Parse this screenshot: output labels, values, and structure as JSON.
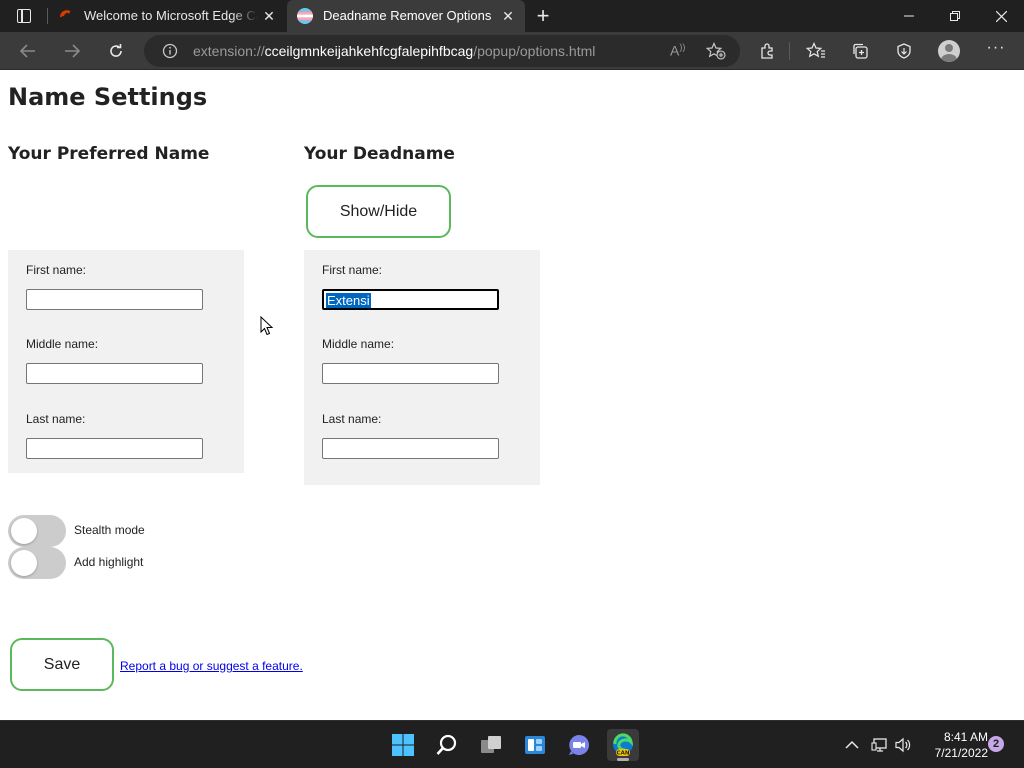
{
  "browser": {
    "tabs": [
      {
        "title": "Welcome to Microsoft Edge Canary",
        "icon": "edge-canary-icon",
        "active": false
      },
      {
        "title": "Deadname Remover Options",
        "icon": "trans-flag-icon",
        "active": true
      }
    ],
    "url": {
      "scheme": "extension://",
      "host": "cceilgmnkeijahkehfcgfalepihfbcag",
      "path": "/popup/options.html"
    }
  },
  "page": {
    "title": "Name Settings",
    "preferred": {
      "heading": "Your Preferred Name",
      "first_label": "First name:",
      "first_value": "",
      "middle_label": "Middle name:",
      "middle_value": "",
      "last_label": "Last name:",
      "last_value": ""
    },
    "deadname": {
      "heading": "Your Deadname",
      "show_hide_label": "Show/Hide",
      "first_label": "First name:",
      "first_value": "Extensi",
      "middle_label": "Middle name:",
      "middle_value": "",
      "last_label": "Last name:",
      "last_value": ""
    },
    "toggles": [
      {
        "label": "Stealth mode",
        "checked": false
      },
      {
        "label": "Add highlight",
        "checked": false
      }
    ],
    "save_label": "Save",
    "report_link": "Report a bug or suggest a feature."
  },
  "taskbar": {
    "time": "8:41 AM",
    "date": "7/21/2022",
    "notifications": "2"
  },
  "colors": {
    "accent_green": "#5cb85c",
    "selection_blue": "#0067c0",
    "panel_gray": "#f1f1f1"
  }
}
